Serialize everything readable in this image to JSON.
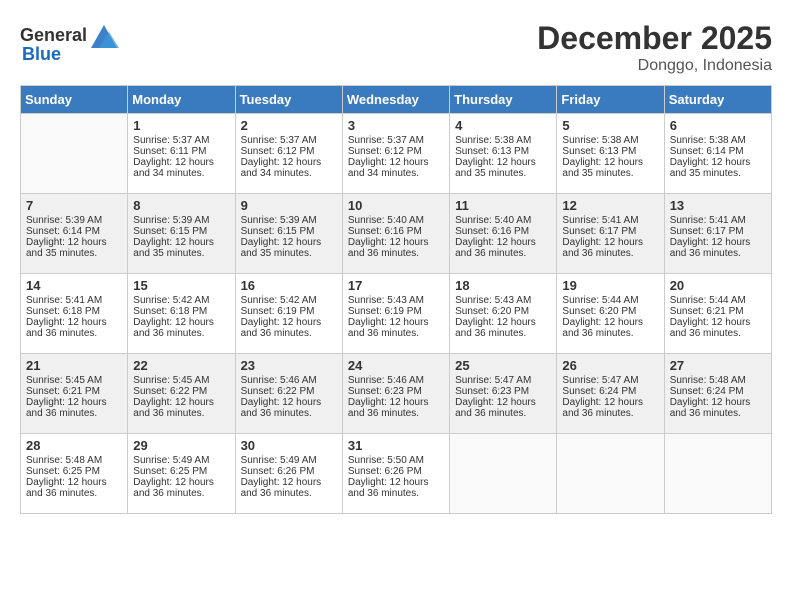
{
  "header": {
    "logo_general": "General",
    "logo_blue": "Blue",
    "month_year": "December 2025",
    "location": "Donggo, Indonesia"
  },
  "days_of_week": [
    "Sunday",
    "Monday",
    "Tuesday",
    "Wednesday",
    "Thursday",
    "Friday",
    "Saturday"
  ],
  "weeks": [
    [
      {
        "day": null,
        "sunrise": null,
        "sunset": null,
        "daylight": null
      },
      {
        "day": "1",
        "sunrise": "Sunrise: 5:37 AM",
        "sunset": "Sunset: 6:11 PM",
        "daylight": "Daylight: 12 hours and 34 minutes."
      },
      {
        "day": "2",
        "sunrise": "Sunrise: 5:37 AM",
        "sunset": "Sunset: 6:12 PM",
        "daylight": "Daylight: 12 hours and 34 minutes."
      },
      {
        "day": "3",
        "sunrise": "Sunrise: 5:37 AM",
        "sunset": "Sunset: 6:12 PM",
        "daylight": "Daylight: 12 hours and 34 minutes."
      },
      {
        "day": "4",
        "sunrise": "Sunrise: 5:38 AM",
        "sunset": "Sunset: 6:13 PM",
        "daylight": "Daylight: 12 hours and 35 minutes."
      },
      {
        "day": "5",
        "sunrise": "Sunrise: 5:38 AM",
        "sunset": "Sunset: 6:13 PM",
        "daylight": "Daylight: 12 hours and 35 minutes."
      },
      {
        "day": "6",
        "sunrise": "Sunrise: 5:38 AM",
        "sunset": "Sunset: 6:14 PM",
        "daylight": "Daylight: 12 hours and 35 minutes."
      }
    ],
    [
      {
        "day": "7",
        "sunrise": "Sunrise: 5:39 AM",
        "sunset": "Sunset: 6:14 PM",
        "daylight": "Daylight: 12 hours and 35 minutes."
      },
      {
        "day": "8",
        "sunrise": "Sunrise: 5:39 AM",
        "sunset": "Sunset: 6:15 PM",
        "daylight": "Daylight: 12 hours and 35 minutes."
      },
      {
        "day": "9",
        "sunrise": "Sunrise: 5:39 AM",
        "sunset": "Sunset: 6:15 PM",
        "daylight": "Daylight: 12 hours and 35 minutes."
      },
      {
        "day": "10",
        "sunrise": "Sunrise: 5:40 AM",
        "sunset": "Sunset: 6:16 PM",
        "daylight": "Daylight: 12 hours and 36 minutes."
      },
      {
        "day": "11",
        "sunrise": "Sunrise: 5:40 AM",
        "sunset": "Sunset: 6:16 PM",
        "daylight": "Daylight: 12 hours and 36 minutes."
      },
      {
        "day": "12",
        "sunrise": "Sunrise: 5:41 AM",
        "sunset": "Sunset: 6:17 PM",
        "daylight": "Daylight: 12 hours and 36 minutes."
      },
      {
        "day": "13",
        "sunrise": "Sunrise: 5:41 AM",
        "sunset": "Sunset: 6:17 PM",
        "daylight": "Daylight: 12 hours and 36 minutes."
      }
    ],
    [
      {
        "day": "14",
        "sunrise": "Sunrise: 5:41 AM",
        "sunset": "Sunset: 6:18 PM",
        "daylight": "Daylight: 12 hours and 36 minutes."
      },
      {
        "day": "15",
        "sunrise": "Sunrise: 5:42 AM",
        "sunset": "Sunset: 6:18 PM",
        "daylight": "Daylight: 12 hours and 36 minutes."
      },
      {
        "day": "16",
        "sunrise": "Sunrise: 5:42 AM",
        "sunset": "Sunset: 6:19 PM",
        "daylight": "Daylight: 12 hours and 36 minutes."
      },
      {
        "day": "17",
        "sunrise": "Sunrise: 5:43 AM",
        "sunset": "Sunset: 6:19 PM",
        "daylight": "Daylight: 12 hours and 36 minutes."
      },
      {
        "day": "18",
        "sunrise": "Sunrise: 5:43 AM",
        "sunset": "Sunset: 6:20 PM",
        "daylight": "Daylight: 12 hours and 36 minutes."
      },
      {
        "day": "19",
        "sunrise": "Sunrise: 5:44 AM",
        "sunset": "Sunset: 6:20 PM",
        "daylight": "Daylight: 12 hours and 36 minutes."
      },
      {
        "day": "20",
        "sunrise": "Sunrise: 5:44 AM",
        "sunset": "Sunset: 6:21 PM",
        "daylight": "Daylight: 12 hours and 36 minutes."
      }
    ],
    [
      {
        "day": "21",
        "sunrise": "Sunrise: 5:45 AM",
        "sunset": "Sunset: 6:21 PM",
        "daylight": "Daylight: 12 hours and 36 minutes."
      },
      {
        "day": "22",
        "sunrise": "Sunrise: 5:45 AM",
        "sunset": "Sunset: 6:22 PM",
        "daylight": "Daylight: 12 hours and 36 minutes."
      },
      {
        "day": "23",
        "sunrise": "Sunrise: 5:46 AM",
        "sunset": "Sunset: 6:22 PM",
        "daylight": "Daylight: 12 hours and 36 minutes."
      },
      {
        "day": "24",
        "sunrise": "Sunrise: 5:46 AM",
        "sunset": "Sunset: 6:23 PM",
        "daylight": "Daylight: 12 hours and 36 minutes."
      },
      {
        "day": "25",
        "sunrise": "Sunrise: 5:47 AM",
        "sunset": "Sunset: 6:23 PM",
        "daylight": "Daylight: 12 hours and 36 minutes."
      },
      {
        "day": "26",
        "sunrise": "Sunrise: 5:47 AM",
        "sunset": "Sunset: 6:24 PM",
        "daylight": "Daylight: 12 hours and 36 minutes."
      },
      {
        "day": "27",
        "sunrise": "Sunrise: 5:48 AM",
        "sunset": "Sunset: 6:24 PM",
        "daylight": "Daylight: 12 hours and 36 minutes."
      }
    ],
    [
      {
        "day": "28",
        "sunrise": "Sunrise: 5:48 AM",
        "sunset": "Sunset: 6:25 PM",
        "daylight": "Daylight: 12 hours and 36 minutes."
      },
      {
        "day": "29",
        "sunrise": "Sunrise: 5:49 AM",
        "sunset": "Sunset: 6:25 PM",
        "daylight": "Daylight: 12 hours and 36 minutes."
      },
      {
        "day": "30",
        "sunrise": "Sunrise: 5:49 AM",
        "sunset": "Sunset: 6:26 PM",
        "daylight": "Daylight: 12 hours and 36 minutes."
      },
      {
        "day": "31",
        "sunrise": "Sunrise: 5:50 AM",
        "sunset": "Sunset: 6:26 PM",
        "daylight": "Daylight: 12 hours and 36 minutes."
      },
      {
        "day": null,
        "sunrise": null,
        "sunset": null,
        "daylight": null
      },
      {
        "day": null,
        "sunrise": null,
        "sunset": null,
        "daylight": null
      },
      {
        "day": null,
        "sunrise": null,
        "sunset": null,
        "daylight": null
      }
    ]
  ]
}
